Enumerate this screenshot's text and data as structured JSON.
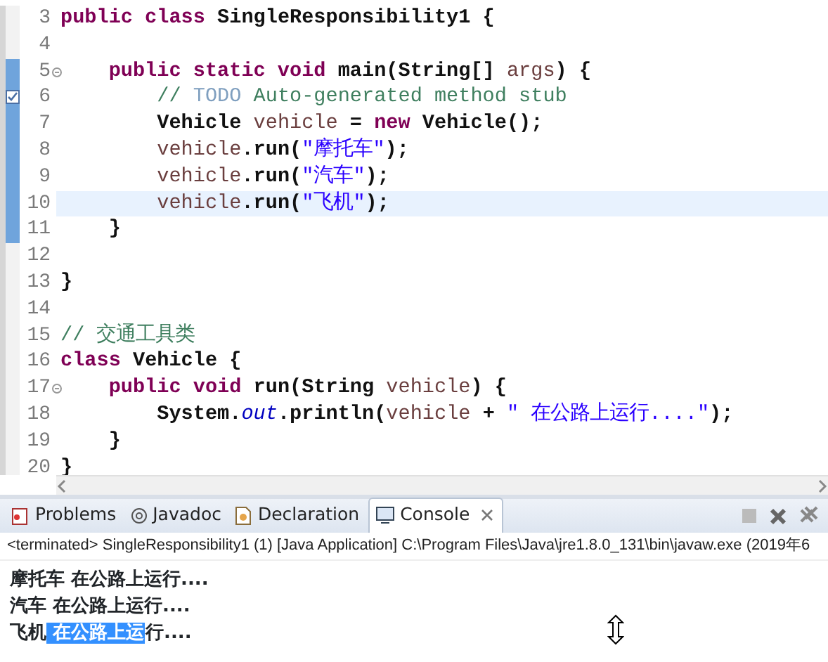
{
  "editor": {
    "lines": [
      {
        "number": "3",
        "current": false,
        "changed": false,
        "fold": false,
        "task": false,
        "tokens": [
          {
            "kind": "keyword",
            "text": "public class "
          },
          {
            "kind": "plain",
            "text": "SingleResponsibility1 {"
          }
        ]
      },
      {
        "number": "4",
        "current": false,
        "changed": false,
        "fold": false,
        "task": false
      },
      {
        "number": "5",
        "current": false,
        "changed": true,
        "fold": true,
        "task": false,
        "tokens": [
          {
            "kind": "keyword",
            "text": "    public static void "
          },
          {
            "kind": "plain",
            "text": "main(String[] "
          },
          {
            "kind": "variable",
            "text": "args"
          },
          {
            "kind": "plain",
            "text": ") {"
          }
        ]
      },
      {
        "number": "6",
        "current": false,
        "changed": true,
        "fold": false,
        "task": true,
        "tokens": [
          {
            "kind": "comment",
            "text": "        // "
          },
          {
            "kind": "todo",
            "text": "TODO"
          },
          {
            "kind": "comment",
            "text": " Auto-generated method stub"
          }
        ]
      },
      {
        "number": "7",
        "current": false,
        "changed": true,
        "fold": false,
        "task": false,
        "tokens": [
          {
            "kind": "plain",
            "text": "        Vehicle "
          },
          {
            "kind": "variable",
            "text": "vehicle"
          },
          {
            "kind": "plain",
            "text": " = "
          },
          {
            "kind": "keyword",
            "text": "new"
          },
          {
            "kind": "plain",
            "text": " Vehicle();"
          }
        ]
      },
      {
        "number": "8",
        "current": false,
        "changed": true,
        "fold": false,
        "task": false,
        "tokens": [
          {
            "kind": "variable",
            "text": "        vehicle"
          },
          {
            "kind": "plain",
            "text": ".run("
          },
          {
            "kind": "string",
            "text": "\"摩托车\""
          },
          {
            "kind": "plain",
            "text": ");"
          }
        ]
      },
      {
        "number": "9",
        "current": false,
        "changed": true,
        "fold": false,
        "task": false,
        "tokens": [
          {
            "kind": "variable",
            "text": "        vehicle"
          },
          {
            "kind": "plain",
            "text": ".run("
          },
          {
            "kind": "string",
            "text": "\"汽车\""
          },
          {
            "kind": "plain",
            "text": ");"
          }
        ]
      },
      {
        "number": "10",
        "current": true,
        "changed": true,
        "fold": false,
        "task": false,
        "tokens": [
          {
            "kind": "variable",
            "text": "        vehicle"
          },
          {
            "kind": "plain",
            "text": ".run("
          },
          {
            "kind": "string",
            "text": "\"飞机\""
          },
          {
            "kind": "plain",
            "text": ");"
          }
        ]
      },
      {
        "number": "11",
        "current": false,
        "changed": true,
        "fold": false,
        "task": false,
        "tokens": [
          {
            "kind": "plain",
            "text": "    }"
          }
        ]
      },
      {
        "number": "12",
        "current": false,
        "changed": false,
        "fold": false,
        "task": false
      },
      {
        "number": "13",
        "current": false,
        "changed": false,
        "fold": false,
        "task": false,
        "tokens": [
          {
            "kind": "plain",
            "text": "}"
          }
        ]
      },
      {
        "number": "14",
        "current": false,
        "changed": false,
        "fold": false,
        "task": false
      },
      {
        "number": "15",
        "current": false,
        "changed": false,
        "fold": false,
        "task": false,
        "tokens": [
          {
            "kind": "comment",
            "text": "// 交通工具类"
          }
        ]
      },
      {
        "number": "16",
        "current": false,
        "changed": false,
        "fold": false,
        "task": false,
        "tokens": [
          {
            "kind": "keyword",
            "text": "class "
          },
          {
            "kind": "plain",
            "text": "Vehicle {"
          }
        ]
      },
      {
        "number": "17",
        "current": false,
        "changed": false,
        "fold": true,
        "task": false,
        "tokens": [
          {
            "kind": "keyword",
            "text": "    public void "
          },
          {
            "kind": "plain",
            "text": "run(String "
          },
          {
            "kind": "variable",
            "text": "vehicle"
          },
          {
            "kind": "plain",
            "text": ") {"
          }
        ]
      },
      {
        "number": "18",
        "current": false,
        "changed": false,
        "fold": false,
        "task": false,
        "tokens": [
          {
            "kind": "plain",
            "text": "        System."
          },
          {
            "kind": "field",
            "text": "out"
          },
          {
            "kind": "plain",
            "text": ".println("
          },
          {
            "kind": "variable",
            "text": "vehicle"
          },
          {
            "kind": "plain",
            "text": " + "
          },
          {
            "kind": "string",
            "text": "\" 在公路上运行....\""
          },
          {
            "kind": "plain",
            "text": ");"
          }
        ]
      },
      {
        "number": "19",
        "current": false,
        "changed": false,
        "fold": false,
        "task": false,
        "tokens": [
          {
            "kind": "plain",
            "text": "    }"
          }
        ]
      },
      {
        "number": "20",
        "current": false,
        "changed": false,
        "fold": false,
        "task": false,
        "tokens": [
          {
            "kind": "plain",
            "text": "}"
          }
        ]
      }
    ]
  },
  "panel": {
    "tabs": [
      {
        "label": "Problems",
        "kind": "problems",
        "selected": false
      },
      {
        "label": "Javadoc",
        "kind": "javadoc",
        "selected": false
      },
      {
        "label": "Declaration",
        "kind": "declaration",
        "selected": false
      },
      {
        "label": "Console",
        "kind": "console",
        "selected": true
      }
    ],
    "console": {
      "header": "<terminated> SingleResponsibility1 (1) [Java Application] C:\\Program Files\\Java\\jre1.8.0_131\\bin\\javaw.exe (2019年6",
      "lines": [
        [
          {
            "text": "摩托车 在公路上运行....",
            "selected": false
          }
        ],
        [
          {
            "text": "汽车 在公路上运行....",
            "selected": false
          }
        ],
        [
          {
            "text": "飞机",
            "selected": false
          },
          {
            "text": " 在公路上运",
            "selected": true
          },
          {
            "text": "行....",
            "selected": false
          }
        ]
      ]
    }
  }
}
